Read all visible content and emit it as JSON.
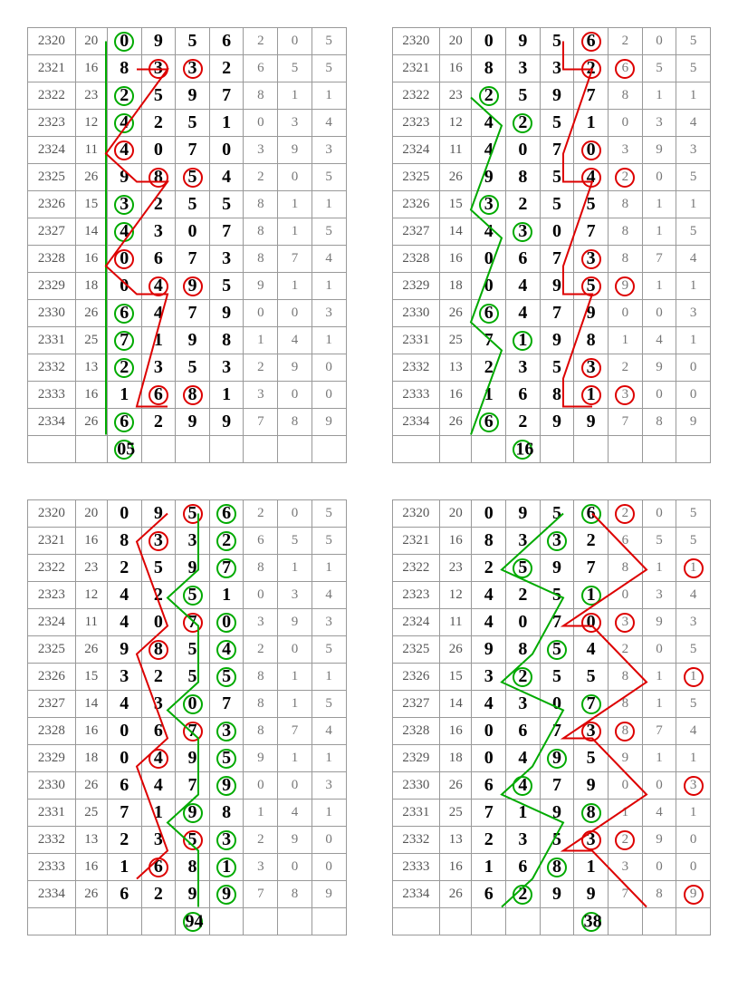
{
  "chart_data": [
    {
      "id": "top-left",
      "rows": [
        {
          "period": "2320",
          "h": "20",
          "d": [
            "0",
            "9",
            "5",
            "6"
          ],
          "t": [
            "2",
            "0",
            "5"
          ]
        },
        {
          "period": "2321",
          "h": "16",
          "d": [
            "8",
            "3",
            "3",
            "2"
          ],
          "t": [
            "6",
            "5",
            "5"
          ]
        },
        {
          "period": "2322",
          "h": "23",
          "d": [
            "2",
            "5",
            "9",
            "7"
          ],
          "t": [
            "8",
            "1",
            "1"
          ]
        },
        {
          "period": "2323",
          "h": "12",
          "d": [
            "4",
            "2",
            "5",
            "1"
          ],
          "t": [
            "0",
            "3",
            "4"
          ]
        },
        {
          "period": "2324",
          "h": "11",
          "d": [
            "4",
            "0",
            "7",
            "0"
          ],
          "t": [
            "3",
            "9",
            "3"
          ]
        },
        {
          "period": "2325",
          "h": "26",
          "d": [
            "9",
            "8",
            "5",
            "4"
          ],
          "t": [
            "2",
            "0",
            "5"
          ]
        },
        {
          "period": "2326",
          "h": "15",
          "d": [
            "3",
            "2",
            "5",
            "5"
          ],
          "t": [
            "8",
            "1",
            "1"
          ]
        },
        {
          "period": "2327",
          "h": "14",
          "d": [
            "4",
            "3",
            "0",
            "7"
          ],
          "t": [
            "8",
            "1",
            "5"
          ]
        },
        {
          "period": "2328",
          "h": "16",
          "d": [
            "0",
            "6",
            "7",
            "3"
          ],
          "t": [
            "8",
            "7",
            "4"
          ]
        },
        {
          "period": "2329",
          "h": "18",
          "d": [
            "0",
            "4",
            "9",
            "5"
          ],
          "t": [
            "9",
            "1",
            "1"
          ]
        },
        {
          "period": "2330",
          "h": "26",
          "d": [
            "6",
            "4",
            "7",
            "9"
          ],
          "t": [
            "0",
            "0",
            "3"
          ]
        },
        {
          "period": "2331",
          "h": "25",
          "d": [
            "7",
            "1",
            "9",
            "8"
          ],
          "t": [
            "1",
            "4",
            "1"
          ]
        },
        {
          "period": "2332",
          "h": "13",
          "d": [
            "2",
            "3",
            "5",
            "3"
          ],
          "t": [
            "2",
            "9",
            "0"
          ]
        },
        {
          "period": "2333",
          "h": "16",
          "d": [
            "1",
            "6",
            "8",
            "1"
          ],
          "t": [
            "3",
            "0",
            "0"
          ]
        },
        {
          "period": "2334",
          "h": "26",
          "d": [
            "6",
            "2",
            "9",
            "9"
          ],
          "t": [
            "7",
            "8",
            "9"
          ]
        }
      ],
      "greens": [
        [
          0,
          0
        ],
        [
          2,
          0
        ],
        [
          3,
          0
        ],
        [
          6,
          0
        ],
        [
          7,
          0
        ],
        [
          10,
          0
        ],
        [
          11,
          0
        ],
        [
          12,
          0
        ],
        [
          14,
          0
        ]
      ],
      "reds": [
        [
          1,
          1
        ],
        [
          1,
          2
        ],
        [
          4,
          0
        ],
        [
          5,
          1
        ],
        [
          5,
          2
        ],
        [
          8,
          0
        ],
        [
          9,
          1
        ],
        [
          9,
          2
        ],
        [
          13,
          1
        ],
        [
          13,
          2
        ]
      ],
      "bottom": {
        "col": 0,
        "text": "05"
      }
    },
    {
      "id": "top-right",
      "rows": "same",
      "greens": [
        [
          2,
          0
        ],
        [
          3,
          1
        ],
        [
          6,
          0
        ],
        [
          7,
          1
        ],
        [
          10,
          0
        ],
        [
          11,
          1
        ],
        [
          14,
          0
        ]
      ],
      "reds": [
        [
          0,
          3
        ],
        [
          1,
          3
        ],
        [
          1,
          4
        ],
        [
          4,
          3
        ],
        [
          5,
          3
        ],
        [
          5,
          4
        ],
        [
          8,
          3
        ],
        [
          9,
          3
        ],
        [
          9,
          4
        ],
        [
          12,
          3
        ],
        [
          13,
          3
        ],
        [
          13,
          4
        ]
      ],
      "bottom": {
        "col": 1,
        "text": "16"
      }
    },
    {
      "id": "bottom-left",
      "rows": "same",
      "greens": [
        [
          0,
          3
        ],
        [
          1,
          3
        ],
        [
          2,
          3
        ],
        [
          3,
          2
        ],
        [
          4,
          3
        ],
        [
          5,
          3
        ],
        [
          6,
          3
        ],
        [
          7,
          2
        ],
        [
          8,
          3
        ],
        [
          9,
          3
        ],
        [
          10,
          3
        ],
        [
          11,
          2
        ],
        [
          12,
          3
        ],
        [
          13,
          3
        ],
        [
          14,
          3
        ]
      ],
      "reds": [
        [
          0,
          2
        ],
        [
          1,
          1
        ],
        [
          4,
          2
        ],
        [
          5,
          1
        ],
        [
          8,
          2
        ],
        [
          9,
          1
        ],
        [
          12,
          2
        ],
        [
          13,
          1
        ]
      ],
      "bottom": {
        "col": 2,
        "text": "94"
      }
    },
    {
      "id": "bottom-right",
      "rows": "same",
      "greens": [
        [
          0,
          3
        ],
        [
          1,
          2
        ],
        [
          2,
          1
        ],
        [
          3,
          3
        ],
        [
          5,
          2
        ],
        [
          6,
          1
        ],
        [
          7,
          3
        ],
        [
          9,
          2
        ],
        [
          10,
          1
        ],
        [
          11,
          3
        ],
        [
          13,
          2
        ],
        [
          14,
          1
        ]
      ],
      "reds": [
        [
          0,
          4
        ],
        [
          2,
          6
        ],
        [
          4,
          3
        ],
        [
          4,
          4
        ],
        [
          6,
          6
        ],
        [
          8,
          3
        ],
        [
          8,
          4
        ],
        [
          10,
          6
        ],
        [
          12,
          3
        ],
        [
          12,
          4
        ],
        [
          14,
          6
        ]
      ],
      "bottom": {
        "col": 3,
        "text": "38"
      }
    }
  ]
}
